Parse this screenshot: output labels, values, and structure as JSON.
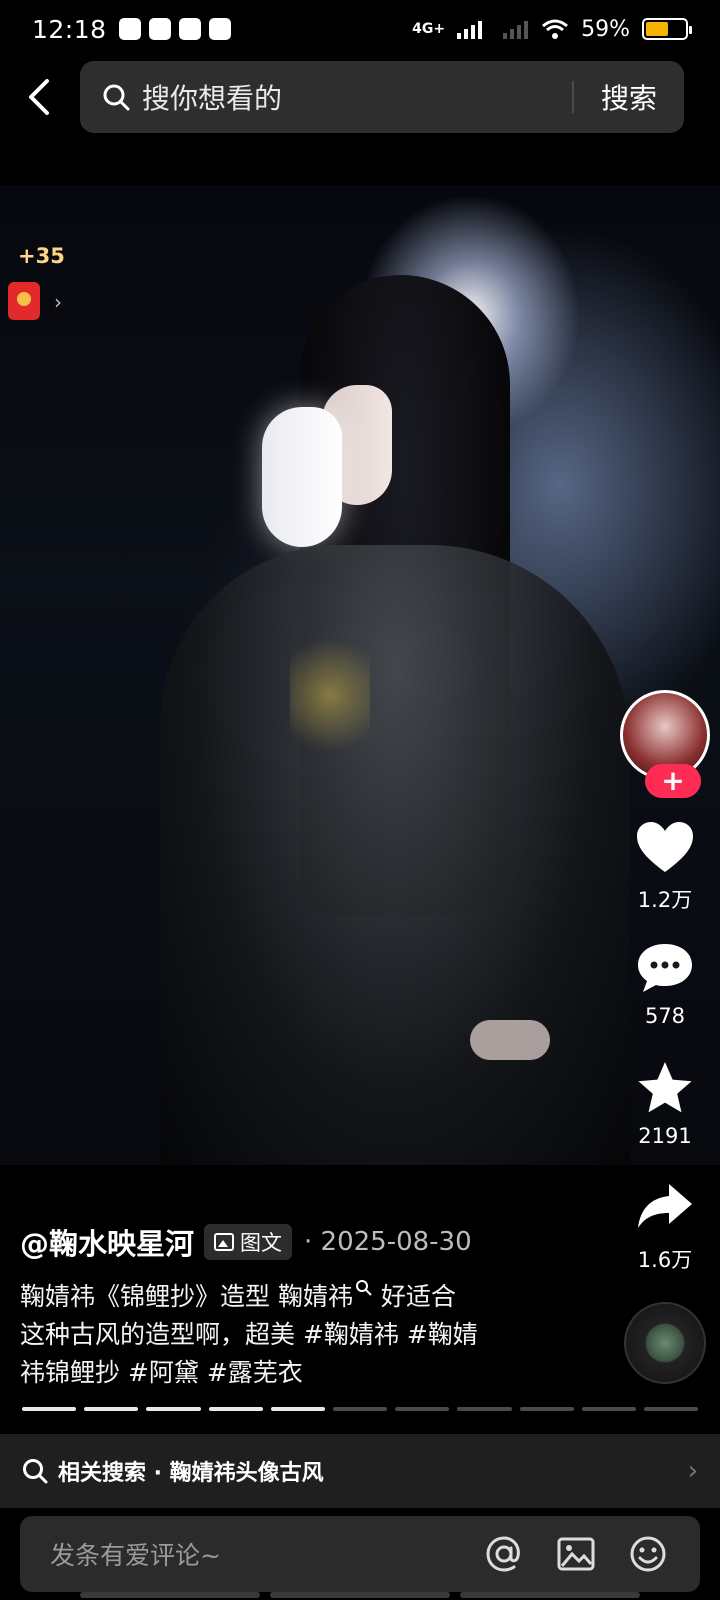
{
  "status_bar": {
    "time": "12:18",
    "network": "4G+",
    "battery": "59%",
    "battery_level": 0.59,
    "battery_color": "#f6b400"
  },
  "header": {
    "back_icon": "chevron-left-icon",
    "search_placeholder": "搜你想看的",
    "search_button": "搜索"
  },
  "reward": {
    "count": "+35",
    "icon": "red-packet-icon"
  },
  "actions": {
    "like_count": "1.2万",
    "comment_count": "578",
    "favorite_count": "2191",
    "share_count": "1.6万",
    "follow_color": "#fe2c55"
  },
  "caption": {
    "author": "@鞠水映星河",
    "type_badge": "图文",
    "date": "· 2025-08-30",
    "line1": "鞠婧祎《锦鲤抄》造型 鞠婧祎",
    "line1b": " 好适合",
    "line2": "这种古风的造型啊，超美 #鞠婧祎 #鞠婧",
    "line3": "祎锦鲤抄 #阿黛 #露芜衣"
  },
  "progress": {
    "total": 11,
    "current": 5
  },
  "related_search": {
    "label": "相关搜索 · 鞠婧祎头像古风"
  },
  "comment_bar": {
    "placeholder": "发条有爱评论~"
  }
}
